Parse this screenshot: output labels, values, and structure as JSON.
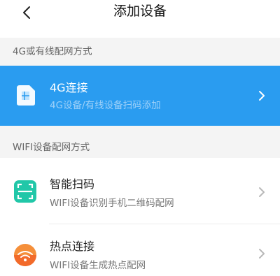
{
  "header": {
    "title": "添加设备",
    "back_icon": "chevron-left-icon"
  },
  "sections": {
    "wired": {
      "label": "4G或有线配网方式"
    },
    "wifi": {
      "label": "WIFI设备配网方式"
    }
  },
  "items": {
    "g4": {
      "title": "4G连接",
      "subtitle": "4G设备/有线设备扫码添加",
      "icon": "sim-card-icon",
      "accent": "#2a9cf0"
    },
    "scan": {
      "title": "智能扫码",
      "subtitle": "WIFI设备识别手机二维码配网",
      "icon": "qr-scan-icon",
      "accent": "#21c7a8"
    },
    "hotspot": {
      "title": "热点连接",
      "subtitle": "WIFI设备生成热点配网",
      "icon": "hotspot-icon",
      "accent": "#f07a2a"
    }
  }
}
